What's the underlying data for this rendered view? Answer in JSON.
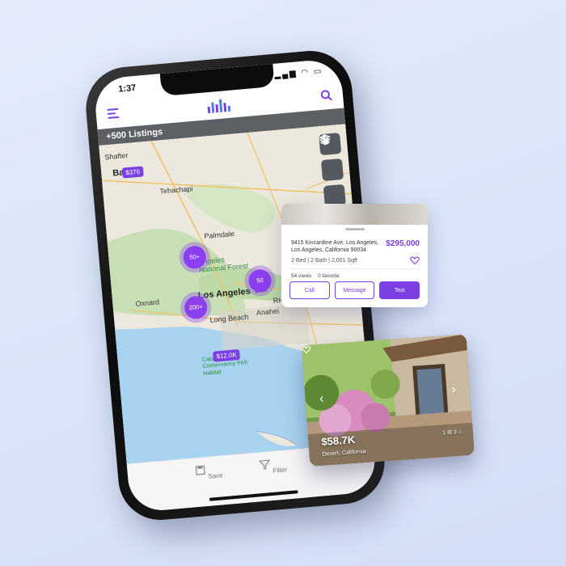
{
  "status_bar": {
    "time": "1:37"
  },
  "listings_bar": {
    "label": "+500 Listings"
  },
  "map": {
    "labels": {
      "shafter": "Shafter",
      "bakersfield": "Ba        eld",
      "tehachapi": "Tehachapi",
      "palmdale": "Palmdale",
      "angeles_nf": "Angeles National Forest",
      "los_angeles": "Los Angeles",
      "oxnard": "Oxnard",
      "long_beach": "Long Beach",
      "anaheim": "Anahei",
      "san": "San",
      "riv": "Riv",
      "catalina": "Catalina Island Conservancy Fish Habitat"
    },
    "clusters": {
      "c50": "50+",
      "c200": "200+",
      "c50b": "50"
    },
    "price_tags": {
      "top": "$376",
      "island": "$12.0K"
    }
  },
  "bottom_bar": {
    "save": "Save",
    "filter": "Filter"
  },
  "listing_card": {
    "address": "9415 Kincardine Ave, Los Angeles, Los Angeles, California 90034",
    "price": "$295,000",
    "specs": "2 Bed | 2 Bath | 2,001 Sqft",
    "views": "54 views",
    "favorites": "0 favorite",
    "buttons": {
      "call": "Call",
      "message": "Message",
      "text": "Text"
    }
  },
  "photo_card": {
    "price": "$58.7K",
    "location": "Desert, California",
    "stats": "1 ⊞  3 ⌂"
  },
  "colors": {
    "accent": "#7b3fe4",
    "listings_bar": "#5d6166",
    "background": "#dbe5f8"
  },
  "icons": [
    "menu-icon",
    "logo-icon",
    "search-icon",
    "layers-icon",
    "locate-icon",
    "draw-icon",
    "heart-icon",
    "save-icon",
    "filter-icon",
    "arrow-left-icon",
    "arrow-right-icon"
  ]
}
